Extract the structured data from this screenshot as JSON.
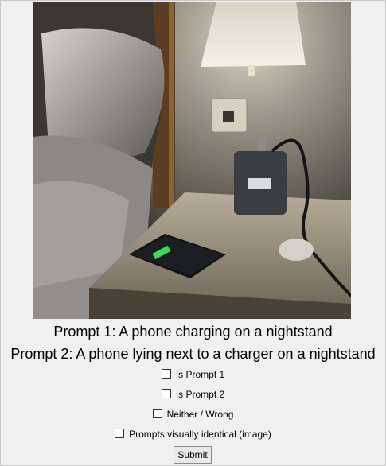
{
  "image": {
    "subject": "phone-charging-nightstand-photo"
  },
  "prompts": {
    "p1": "Prompt 1: A phone charging on a nightstand",
    "p2": "Prompt 2: A phone lying next to a charger on a nightstand"
  },
  "options": [
    {
      "label": "Is Prompt 1",
      "checked": false
    },
    {
      "label": "Is Prompt 2",
      "checked": false
    },
    {
      "label": "Neither / Wrong",
      "checked": false
    },
    {
      "label": "Prompts visually identical (image)",
      "checked": false
    }
  ],
  "submit_label": "Submit"
}
